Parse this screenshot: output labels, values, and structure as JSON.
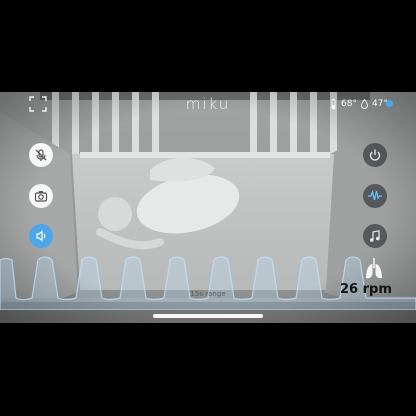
{
  "header": {
    "brand": "miku",
    "temperature": "68°",
    "humidity": "47°",
    "fullscreen_icon": "fullscreen-icon",
    "live_indicator_color": "#4aa8f0"
  },
  "left_controls": [
    {
      "icon": "mic-muted-icon",
      "style": "white"
    },
    {
      "icon": "camera-icon",
      "style": "white"
    },
    {
      "icon": "speaker-icon",
      "style": "blue"
    }
  ],
  "right_controls": [
    {
      "icon": "power-icon"
    },
    {
      "icon": "breathing-waveform-icon"
    },
    {
      "icon": "music-note-icon"
    }
  ],
  "breathing": {
    "rate": "26 rpm",
    "range_label": "15s range",
    "icon": "lungs-icon",
    "wave_color": "#bfe3ff"
  },
  "colors": {
    "accent": "#4ea6ea",
    "overlay_dark": "#3c4246"
  }
}
